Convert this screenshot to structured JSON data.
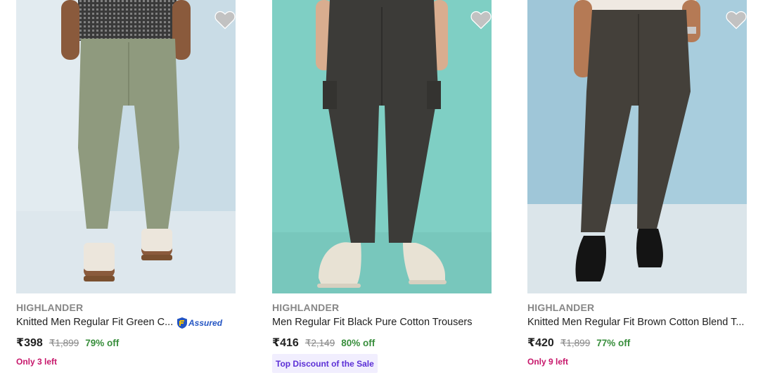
{
  "products": [
    {
      "brand": "HIGHLANDER",
      "title": "Knitted Men Regular Fit Green C...",
      "assured": true,
      "assured_label": "Assured",
      "price": "₹398",
      "mrp": "₹1,899",
      "discount": "79% off",
      "stock_note": "Only 3 left",
      "image_desc": "sage-green-trousers-with-white-sandals",
      "icon": "heart-icon"
    },
    {
      "brand": "HIGHLANDER",
      "title": "Men Regular Fit Black Pure Cotton Trousers",
      "assured": false,
      "price": "₹416",
      "mrp": "₹2,149",
      "discount": "80% off",
      "badge": "Top Discount of the Sale",
      "image_desc": "black-cargo-trousers-with-sneakers",
      "icon": "heart-icon"
    },
    {
      "brand": "HIGHLANDER",
      "title": "Knitted Men Regular Fit Brown Cotton Blend T...",
      "assured": false,
      "price": "₹420",
      "mrp": "₹1,899",
      "discount": "77% off",
      "stock_note": "Only 9 left",
      "image_desc": "brown-trousers-with-black-loafers",
      "icon": "heart-icon"
    }
  ],
  "colors": {
    "brand_gray": "#878787",
    "discount_green": "#388e3c",
    "stock_pink": "#c7176b",
    "badge_bg": "#f1eefe",
    "badge_text": "#5b2fd6",
    "assured_blue": "#2455c3"
  }
}
